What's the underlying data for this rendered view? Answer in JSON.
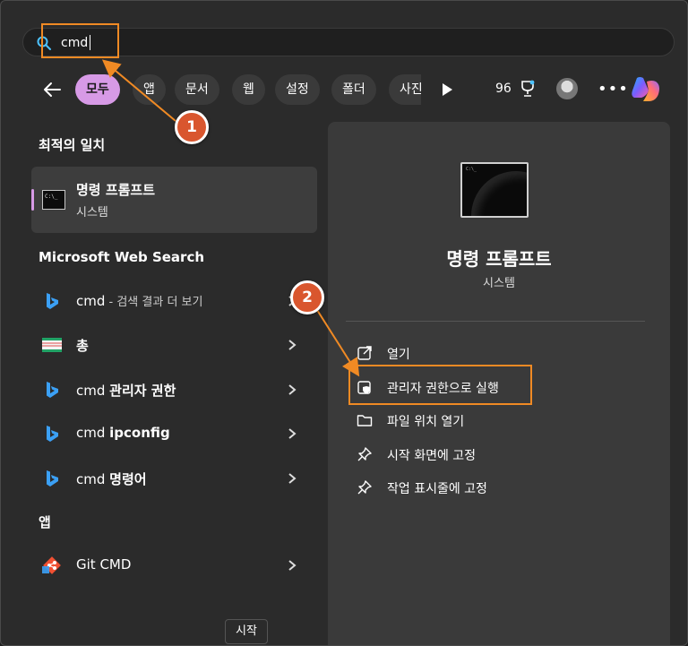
{
  "search": {
    "value": "cmd",
    "placeholder": ""
  },
  "filters": {
    "chips": [
      "모두",
      "앱",
      "문서",
      "웹",
      "설정",
      "폴더",
      "사진"
    ],
    "score": "96"
  },
  "left": {
    "best_match_header": "최적의 일치",
    "best_match": {
      "title": "명령 프롬프트",
      "subtitle": "시스템"
    },
    "web_header": "Microsoft Web Search",
    "web_rows": [
      {
        "main": "cmd",
        "suffix": " - 검색 결과 더 보기"
      },
      {
        "main": "총",
        "suffix": ""
      },
      {
        "prefix": "cmd ",
        "bold": "관리자 권한"
      },
      {
        "prefix": "cmd ",
        "bold": "ipconfig"
      },
      {
        "prefix": "cmd ",
        "bold": "명령어"
      }
    ],
    "apps_header": "앱",
    "app_row": {
      "label": "Git CMD"
    }
  },
  "panel": {
    "title": "명령 프롬프트",
    "subtitle": "시스템",
    "actions": [
      "열기",
      "관리자 권한으로 실행",
      "파일 위치 열기",
      "시작 화면에 고정",
      "작업 표시줄에 고정"
    ]
  },
  "tooltip": "시작",
  "annotations": {
    "step1": "1",
    "step2": "2"
  },
  "colors": {
    "accent": "#d79ae6",
    "annotation": "#f08a24",
    "badge": "#d9562e"
  }
}
